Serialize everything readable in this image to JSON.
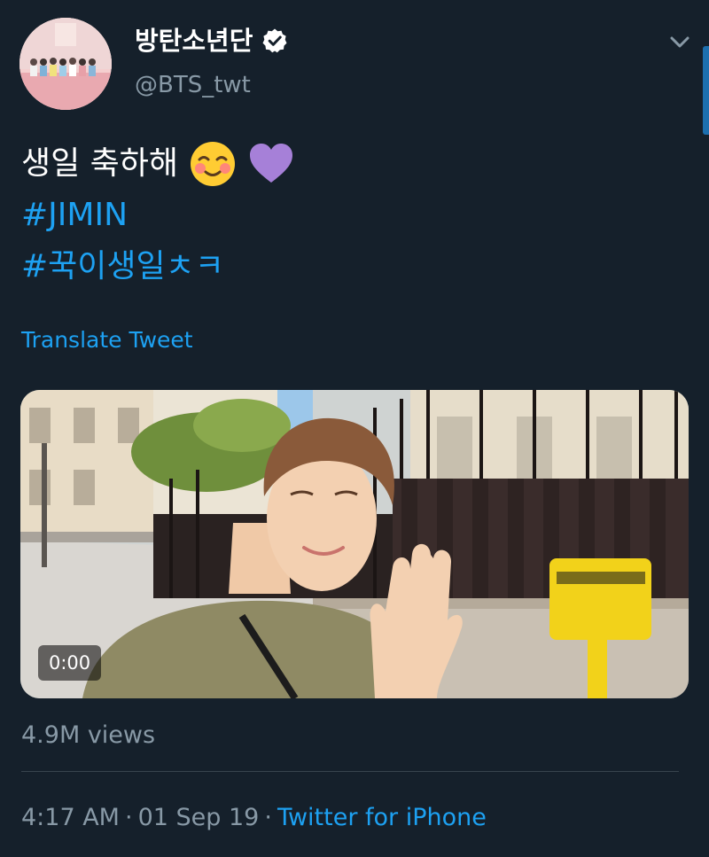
{
  "author": {
    "display_name": "방탄소년단",
    "handle": "@BTS_twt",
    "verified": true,
    "avatar_icon": "group-photo-avatar"
  },
  "tweet": {
    "text": "생일 축하해",
    "emojis": [
      "smiling-face-icon",
      "purple-heart-icon"
    ],
    "hashtags": [
      "#JIMIN",
      "#꾹이생일ㅊㅋ"
    ],
    "translate_label": "Translate Tweet"
  },
  "media": {
    "type": "video",
    "duration": "0:00"
  },
  "stats": {
    "views": "4.9M views"
  },
  "meta": {
    "time": "4:17 AM",
    "date": "01 Sep 19",
    "source": "Twitter for iPhone",
    "separator": "·"
  },
  "colors": {
    "background": "#15202b",
    "link": "#1da1f2",
    "secondary_text": "#8899a6",
    "divider": "#38444d"
  }
}
